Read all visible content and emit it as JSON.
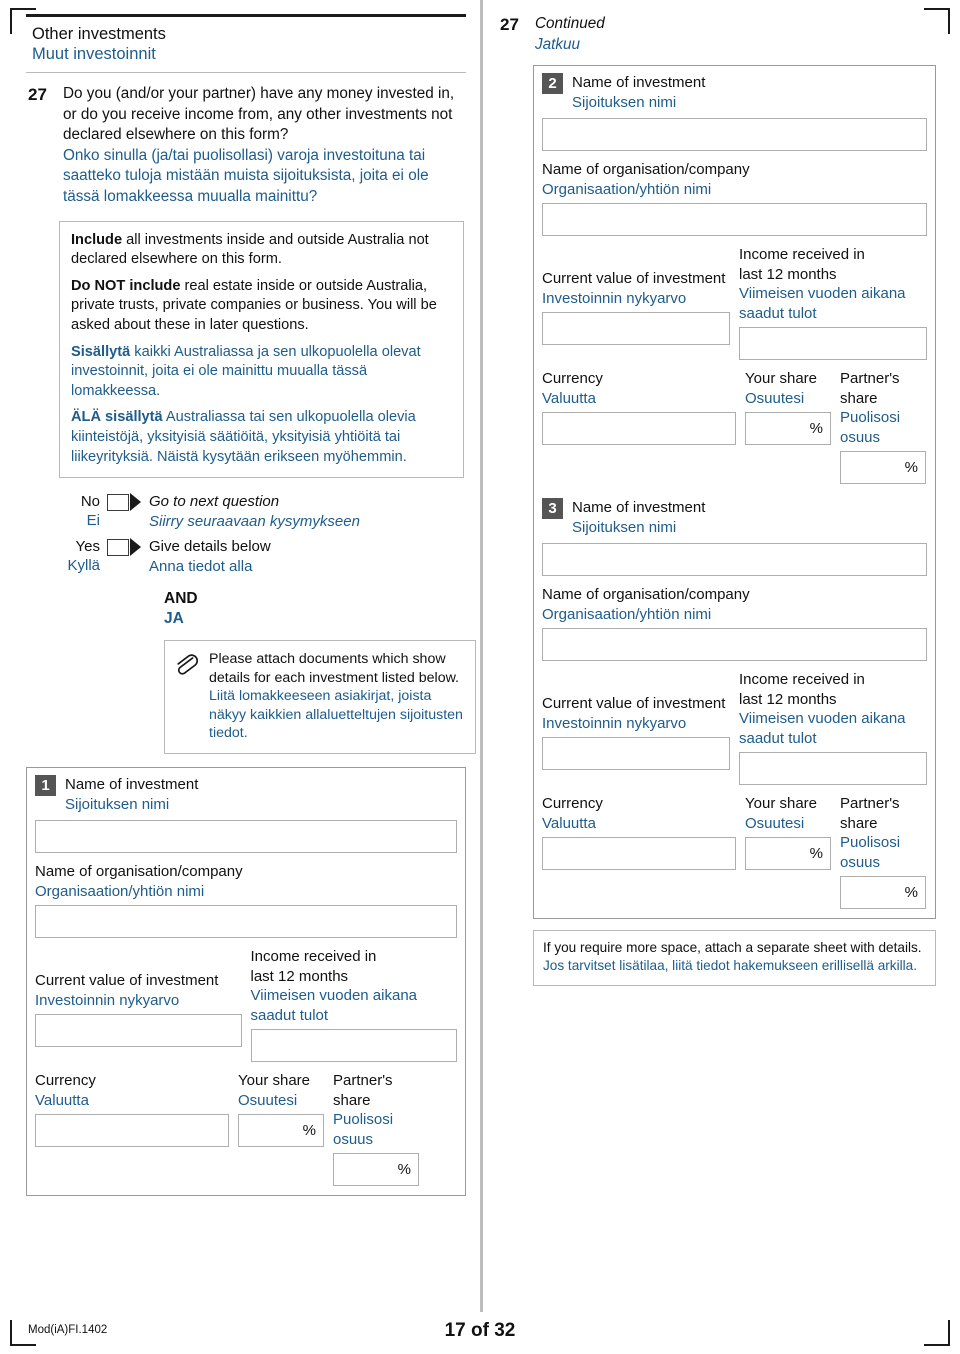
{
  "section": {
    "title_en": "Other investments",
    "title_fi": "Muut investoinnit"
  },
  "question": {
    "number": "27",
    "en": "Do you (and/or your partner) have any money invested in, or do you receive income from, any other investments not declared elsewhere on this form?",
    "fi": "Onko sinulla (ja/tai puolisollasi) varoja investoituna tai saatteko tuloja mistään muista sijoituksista, joita ei ole tässä lomakkeessa muualla mainittu?"
  },
  "instructions": [
    {
      "bold_en": "Include",
      "rest_en": " all investments inside and outside Australia not declared elsewhere on this form.",
      "lang": "en"
    },
    {
      "bold_en": "Do NOT include",
      "rest_en": " real estate inside or outside Australia, private trusts, private companies or business. You will be asked about these in later questions.",
      "lang": "en"
    },
    {
      "bold_en": "Sisällytä",
      "rest_en": " kaikki Australiassa ja sen ulkopuolella olevat investoinnit, joita ei ole mainittu muualla tässä lomakkeessa.",
      "lang": "fi"
    },
    {
      "bold_en": "ÄLÄ sisällytä",
      "rest_en": " Australiassa tai sen ulkopuolella olevia kiinteistöjä, yksityisiä säätiöitä, yksityisiä yhtiöitä tai liikeyrityksiä.  Näistä kysytään erikseen myöhemmin.",
      "lang": "fi"
    }
  ],
  "answers": {
    "no_en": "No",
    "no_fi": "Ei",
    "no_action_en": "Go to next question",
    "no_action_fi": "Siirry seuraavaan kysymykseen",
    "yes_en": "Yes",
    "yes_fi": "Kyllä",
    "yes_action_en": "Give details below",
    "yes_action_fi": "Anna tiedot alla",
    "and_en": "AND",
    "and_fi": "JA"
  },
  "attach_note": {
    "icon": "paperclip-icon",
    "en": "Please attach documents which show details for each investment listed below.",
    "fi": "Liitä lomakkeeseen asiakirjat, joista näkyy kaikkien allaluetteltujen sijoitusten tiedot."
  },
  "labels": {
    "name_of_investment_en": "Name of investment",
    "name_of_investment_fi": "Sijoituksen nimi",
    "organisation_en": "Name of organisation/company",
    "organisation_fi": "Organisaation/yhtiön nimi",
    "current_value_en": "Current value of investment",
    "current_value_fi": "Investoinnin nykyarvo",
    "income_en_line1": "Income received in",
    "income_en_line2": "last 12 months",
    "income_fi_line1": "Viimeisen vuoden aikana",
    "income_fi_line2": "saadut tulot",
    "currency_en": "Currency",
    "currency_fi": "Valuutta",
    "your_share_en": "Your share",
    "your_share_fi": "Osuutesi",
    "partner_share_en": "Partner's share",
    "partner_share_fi": "Puolisosi osuus",
    "percent": "%"
  },
  "blocks": {
    "one": "1",
    "two": "2",
    "three": "3"
  },
  "continued": {
    "number": "27",
    "en": "Continued",
    "fi": "Jatkuu"
  },
  "more_space": {
    "en": "If you require more space, attach a separate sheet with details.",
    "fi": "Jos tarvitset lisätilaa, liitä tiedot hakemukseen erillisellä arkilla."
  },
  "footer": {
    "code": "Mod(iA)FI.1402",
    "page": "17 of 32"
  },
  "colors": {
    "finnish_text": "#1e5c8b",
    "english_text": "#111111",
    "badge_bg": "#555555",
    "field_border": "#aeaeae"
  }
}
